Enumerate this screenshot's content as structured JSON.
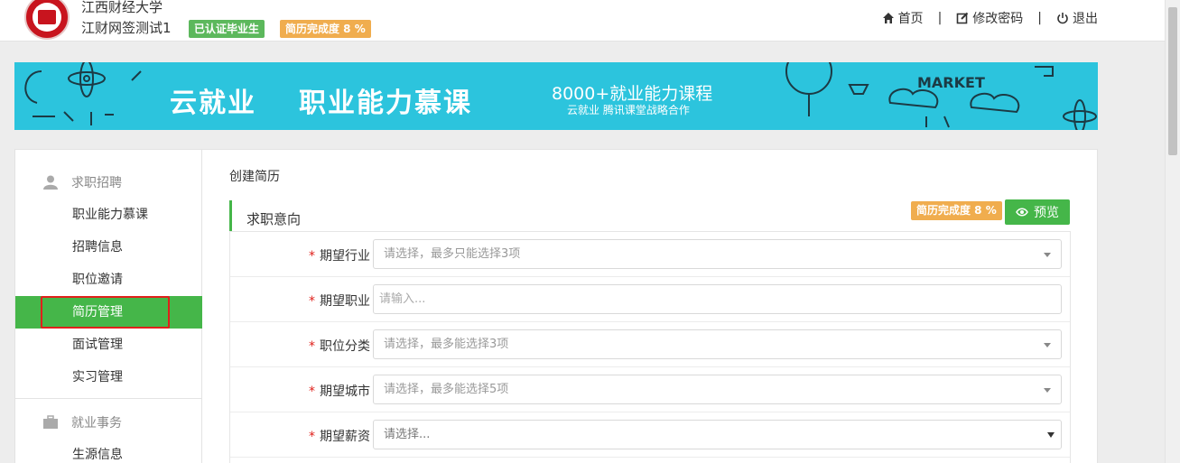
{
  "header": {
    "university": "江西财经大学",
    "username": "江财网签测试1",
    "verified_badge": "已认证毕业生",
    "completion_badge": "简历完成度 8 %",
    "nav": [
      {
        "icon": "home-icon",
        "label": "首页"
      },
      {
        "icon": "edit-icon",
        "label": "修改密码"
      },
      {
        "icon": "power-icon",
        "label": "退出"
      }
    ],
    "separator": "|"
  },
  "banner": {
    "title_part1": "云就业",
    "title_part2": "职业能力慕课",
    "subtitle": "8000+就业能力课程",
    "partner": "云就业  腾讯课堂战略合作",
    "doodle_text": "MARKET",
    "background": "#2cc4dd"
  },
  "sidebar": {
    "sections": [
      {
        "icon": "user-icon",
        "title": "求职招聘",
        "items": [
          "职业能力慕课",
          "招聘信息",
          "职位邀请",
          "简历管理",
          "面试管理",
          "实习管理"
        ]
      },
      {
        "icon": "briefcase-icon",
        "title": "就业事务",
        "items": [
          "生源信息"
        ]
      }
    ],
    "active_item": "简历管理"
  },
  "main": {
    "breadcrumb": "创建简历",
    "section_title": "求职意向",
    "completion_badge": "简历完成度 8 %",
    "preview_button": "预览",
    "fields": [
      {
        "label": "期望行业",
        "placeholder": "请选择，最多只能选择3项",
        "type": "select"
      },
      {
        "label": "期望职业",
        "placeholder": "请输入...",
        "type": "input"
      },
      {
        "label": "职位分类",
        "placeholder": "请选择，最多能选择3项",
        "type": "select"
      },
      {
        "label": "期望城市",
        "placeholder": "请选择，最多能选择5项",
        "type": "select"
      },
      {
        "label": "期望薪资",
        "placeholder": "请选择...",
        "type": "native-select"
      }
    ],
    "required_mark": "*"
  },
  "colors": {
    "accent_green": "#45b649",
    "badge_orange": "#f0ad4e",
    "badge_green": "#5cb85c",
    "highlight_red": "#e0201b",
    "brand_red": "#c8141e"
  }
}
